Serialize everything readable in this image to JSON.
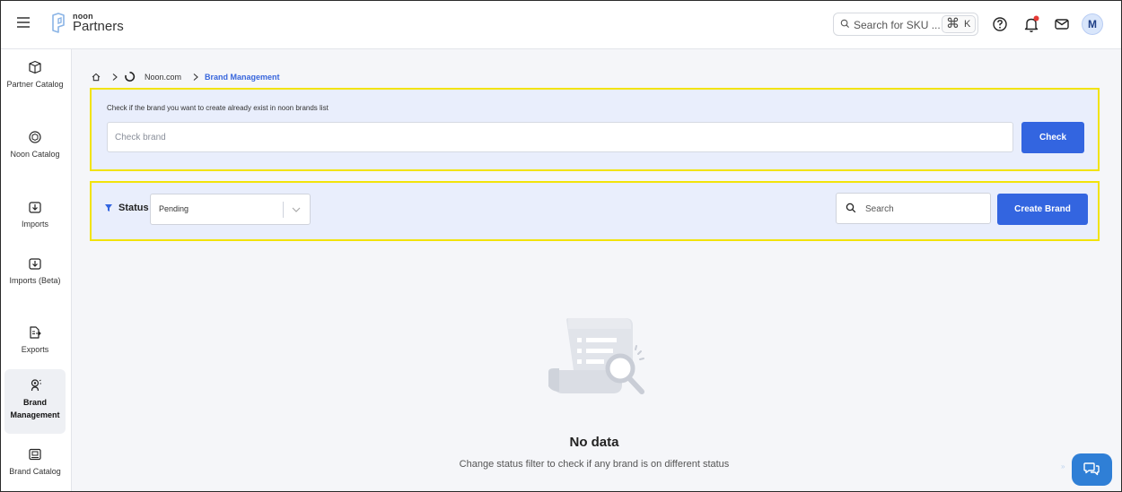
{
  "app": {
    "brand_small": "noon",
    "brand_name": "Partners"
  },
  "topbar": {
    "search_placeholder": "Search for SKU ...",
    "shortcut_symbol": "⌘",
    "shortcut_key": "K",
    "avatar_initial": "M",
    "icons": [
      "help-icon",
      "bell-icon",
      "mail-icon"
    ],
    "notification_dot_color": "#e53935"
  },
  "sidebar": {
    "items": [
      {
        "label": "Partner Catalog",
        "icon": "box-icon"
      },
      {
        "label": "Noon Catalog",
        "icon": "catalog-icon"
      },
      {
        "label": "Imports",
        "icon": "import-icon"
      },
      {
        "label": "Imports (Beta)",
        "icon": "import-beta-icon"
      },
      {
        "label": "Exports",
        "icon": "export-icon"
      },
      {
        "label": "Brand Management",
        "icon": "brand-icon",
        "active": true
      },
      {
        "label": "Brand Catalog",
        "icon": "brand-catalog-icon"
      }
    ]
  },
  "breadcrumb": {
    "site": "Noon.com",
    "current": "Brand Management"
  },
  "check_panel": {
    "label": "Check if the brand you want to create already exist in noon brands list",
    "input_placeholder": "Check brand",
    "button": "Check"
  },
  "filter_panel": {
    "status_label": "Status",
    "status_value": "Pending",
    "search_placeholder": "Search",
    "create_button": "Create Brand"
  },
  "empty_state": {
    "title": "No data",
    "subtitle": "Change status filter to check if any brand is on different status"
  },
  "colors": {
    "accent": "#3365e0",
    "panel_bg": "#e9eefc",
    "highlight_border": "#f2e30a",
    "link": "#3866dc"
  }
}
